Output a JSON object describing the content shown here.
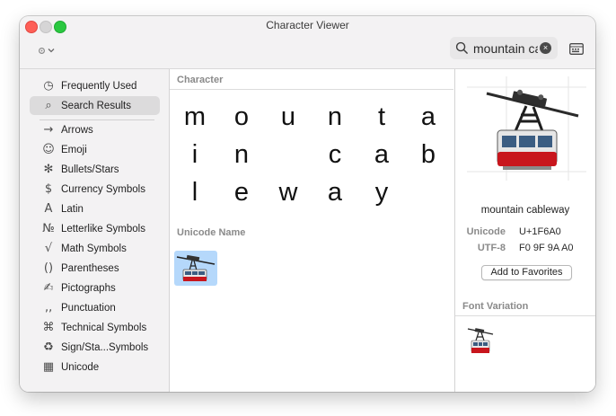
{
  "window": {
    "title": "Character Viewer"
  },
  "toolbar": {
    "action_icon": "gear-dropdown-icon",
    "search_value": "mountain ca",
    "clear_label": "×",
    "viewer_icon": "keyboard-viewer-icon"
  },
  "sidebar": {
    "items": [
      {
        "label": "Frequently Used",
        "icon": "clock-icon",
        "glyph": "◷"
      },
      {
        "label": "Search Results",
        "icon": "magnifier-icon",
        "glyph": "⌕",
        "selected": true
      },
      {
        "label": "Arrows",
        "icon": "arrow-icon",
        "glyph": "→"
      },
      {
        "label": "Emoji",
        "icon": "smiley-icon",
        "glyph": "☺"
      },
      {
        "label": "Bullets/Stars",
        "icon": "asterisk-icon",
        "glyph": "✻"
      },
      {
        "label": "Currency Symbols",
        "icon": "dollar-icon",
        "glyph": "$"
      },
      {
        "label": "Latin",
        "icon": "latin-a-icon",
        "glyph": "A"
      },
      {
        "label": "Letterlike Symbols",
        "icon": "numero-icon",
        "glyph": "№"
      },
      {
        "label": "Math Symbols",
        "icon": "square-root-icon",
        "glyph": "√"
      },
      {
        "label": "Parentheses",
        "icon": "parentheses-icon",
        "glyph": "()"
      },
      {
        "label": "Pictographs",
        "icon": "pictograph-icon",
        "glyph": "✍"
      },
      {
        "label": "Punctuation",
        "icon": "punctuation-icon",
        "glyph": "‚‚"
      },
      {
        "label": "Technical Symbols",
        "icon": "command-icon",
        "glyph": "⌘"
      },
      {
        "label": "Sign/Sta...Symbols",
        "icon": "recycle-icon",
        "glyph": "♻"
      },
      {
        "label": "Unicode",
        "icon": "grid-square-icon",
        "glyph": "▦"
      }
    ]
  },
  "center": {
    "character_label": "Character",
    "characters": [
      "m",
      "o",
      "u",
      "n",
      "t",
      "a",
      "i",
      "n",
      "",
      "c",
      "a",
      "b",
      "l",
      "e",
      "w",
      "a",
      "y"
    ],
    "unicode_name_label": "Unicode Name",
    "result_icon": "mountain-cableway-emoji"
  },
  "detail": {
    "char_name": "mountain cableway",
    "unicode_label": "Unicode",
    "unicode_value": "U+1F6A0",
    "utf8_label": "UTF-8",
    "utf8_value": "F0 9F 9A A0",
    "favorites_label": "Add to Favorites",
    "font_variation_label": "Font Variation"
  },
  "colors": {
    "close": "#fe5f57",
    "zoom": "#2ac840",
    "selection": "#b5d8fb",
    "cable_car_red": "#c8161d"
  }
}
